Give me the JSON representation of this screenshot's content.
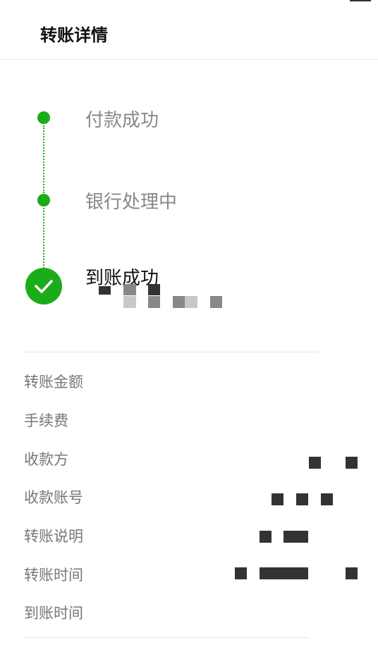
{
  "header": {
    "title": "转账详情"
  },
  "timeline": {
    "steps": [
      {
        "label": "付款成功",
        "state": "done"
      },
      {
        "label": "银行处理中",
        "state": "done"
      },
      {
        "label": "到账成功",
        "state": "current"
      }
    ]
  },
  "details": {
    "rows": [
      {
        "label": "转账金额"
      },
      {
        "label": "手续费"
      },
      {
        "label": "收款方"
      },
      {
        "label": "收款账号"
      },
      {
        "label": "转账说明"
      },
      {
        "label": "转账时间"
      },
      {
        "label": "到账时间"
      }
    ]
  },
  "colors": {
    "accent": "#1aad19",
    "redaction": "#333333"
  },
  "icons": {
    "step_done": "green-dot-icon",
    "step_current": "checkmark-circle-icon"
  }
}
